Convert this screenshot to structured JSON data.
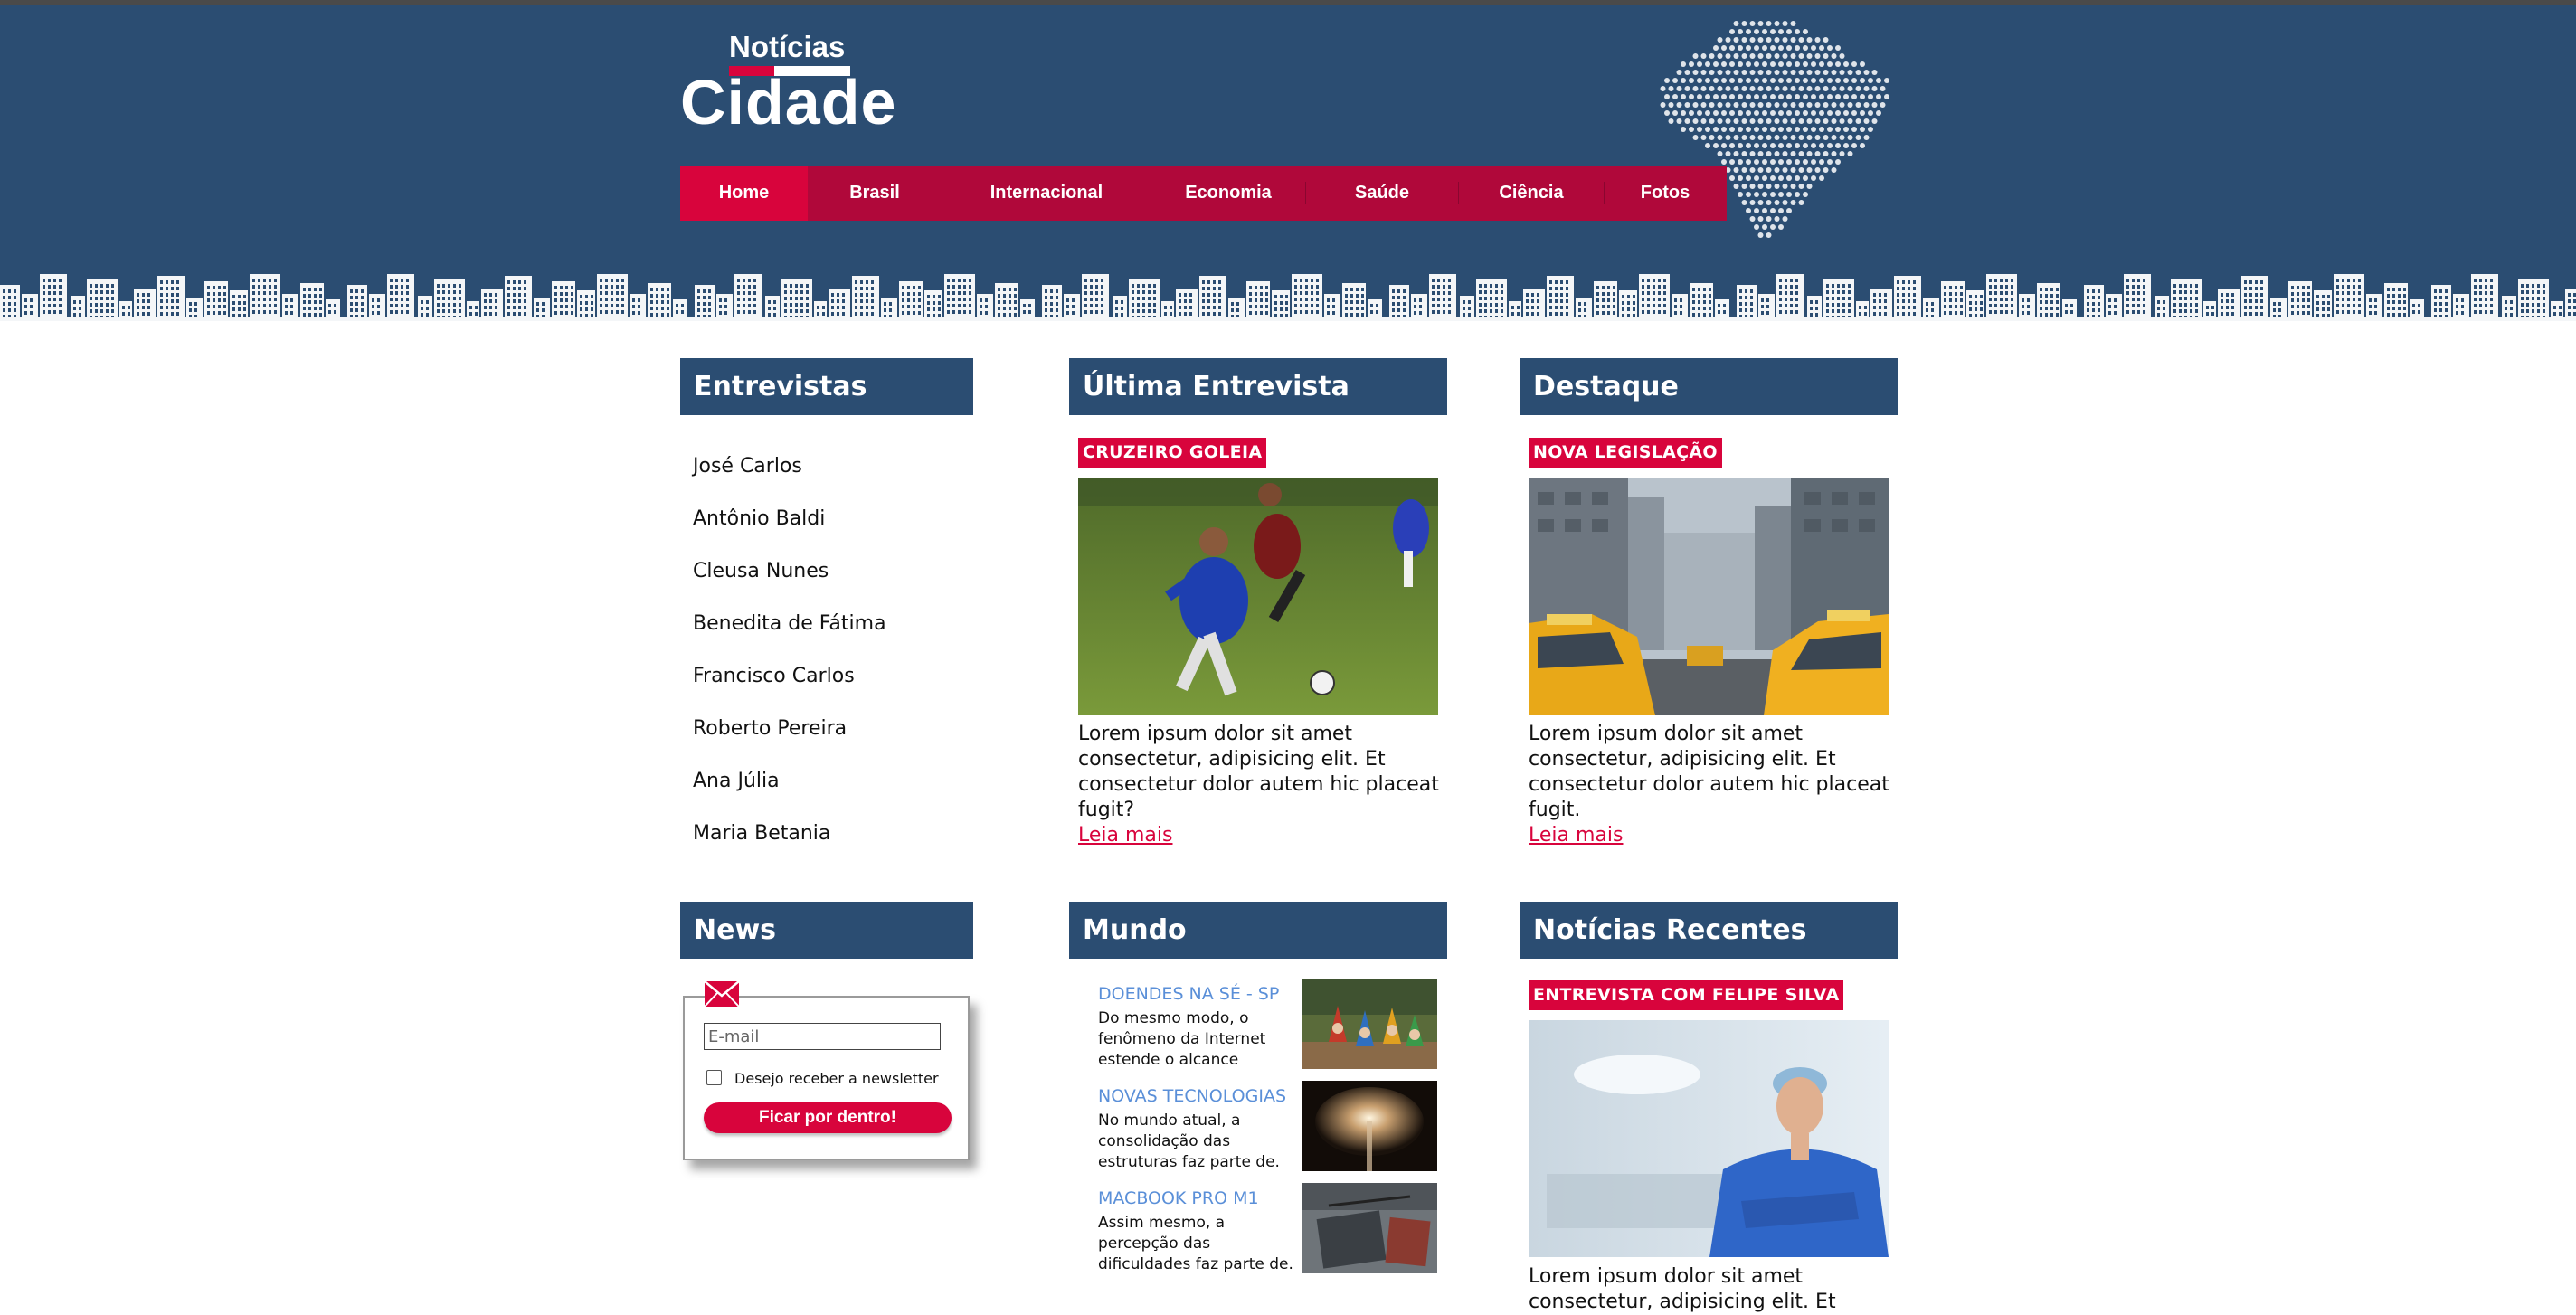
{
  "header": {
    "logo": {
      "small_text": "Notícias",
      "big_text": "Cidade"
    },
    "nav": [
      {
        "label": "Home",
        "active": true
      },
      {
        "label": "Brasil"
      },
      {
        "label": "Internacional"
      },
      {
        "label": "Economia"
      },
      {
        "label": "Saúde"
      },
      {
        "label": "Ciência"
      },
      {
        "label": "Fotos"
      }
    ],
    "colors": {
      "navy": "#2b4d72",
      "accent": "#d8043c",
      "nav_bg": "#b0083a"
    }
  },
  "entrevistas": {
    "title": "Entrevistas",
    "items": [
      "José Carlos",
      "Antônio Baldi",
      "Cleusa Nunes",
      "Benedita de Fátima",
      "Francisco Carlos",
      "Roberto Pereira",
      "Ana Júlia",
      "Maria Betania"
    ]
  },
  "ultima_entrevista": {
    "title": "Última Entrevista",
    "tag": "CRUZEIRO GOLEIA",
    "image": "soccer-players-photo",
    "text": "Lorem ipsum dolor sit amet consectetur, adipisicing elit. Et consectetur dolor autem hic placeat fugit?",
    "link": "Leia mais"
  },
  "destaque": {
    "title": "Destaque",
    "tag": "NOVA LEGISLAÇÃO",
    "image": "city-taxis-photo",
    "text": "Lorem ipsum dolor sit amet consectetur, adipisicing elit. Et consectetur dolor autem hic placeat fugit.",
    "link": "Leia mais"
  },
  "news": {
    "title": "News",
    "email_placeholder": "E-mail",
    "checkbox_label": "Desejo receber a newsletter",
    "button": "Ficar por dentro!"
  },
  "mundo": {
    "title": "Mundo",
    "items": [
      {
        "title": "DOENDES NA SÉ - SP",
        "text": "Do mesmo modo, o fenômeno da Internet estende o alcance",
        "image": "garden-gnomes-photo"
      },
      {
        "title": "NOVAS TECNOLOGIAS",
        "text": "No mundo atual, a consolidação das estruturas faz parte de.",
        "image": "light-effect-photo"
      },
      {
        "title": "MACBOOK PRO M1",
        "text": "Assim mesmo, a percepção das dificuldades faz parte de.",
        "image": "desk-notebook-photo"
      }
    ]
  },
  "recentes": {
    "title": "Notícias Recentes",
    "tag": "ENTREVISTA COM FELIPE SILVA",
    "image": "surgeon-photo",
    "text": "Lorem ipsum dolor sit amet consectetur, adipisicing elit. Et"
  }
}
